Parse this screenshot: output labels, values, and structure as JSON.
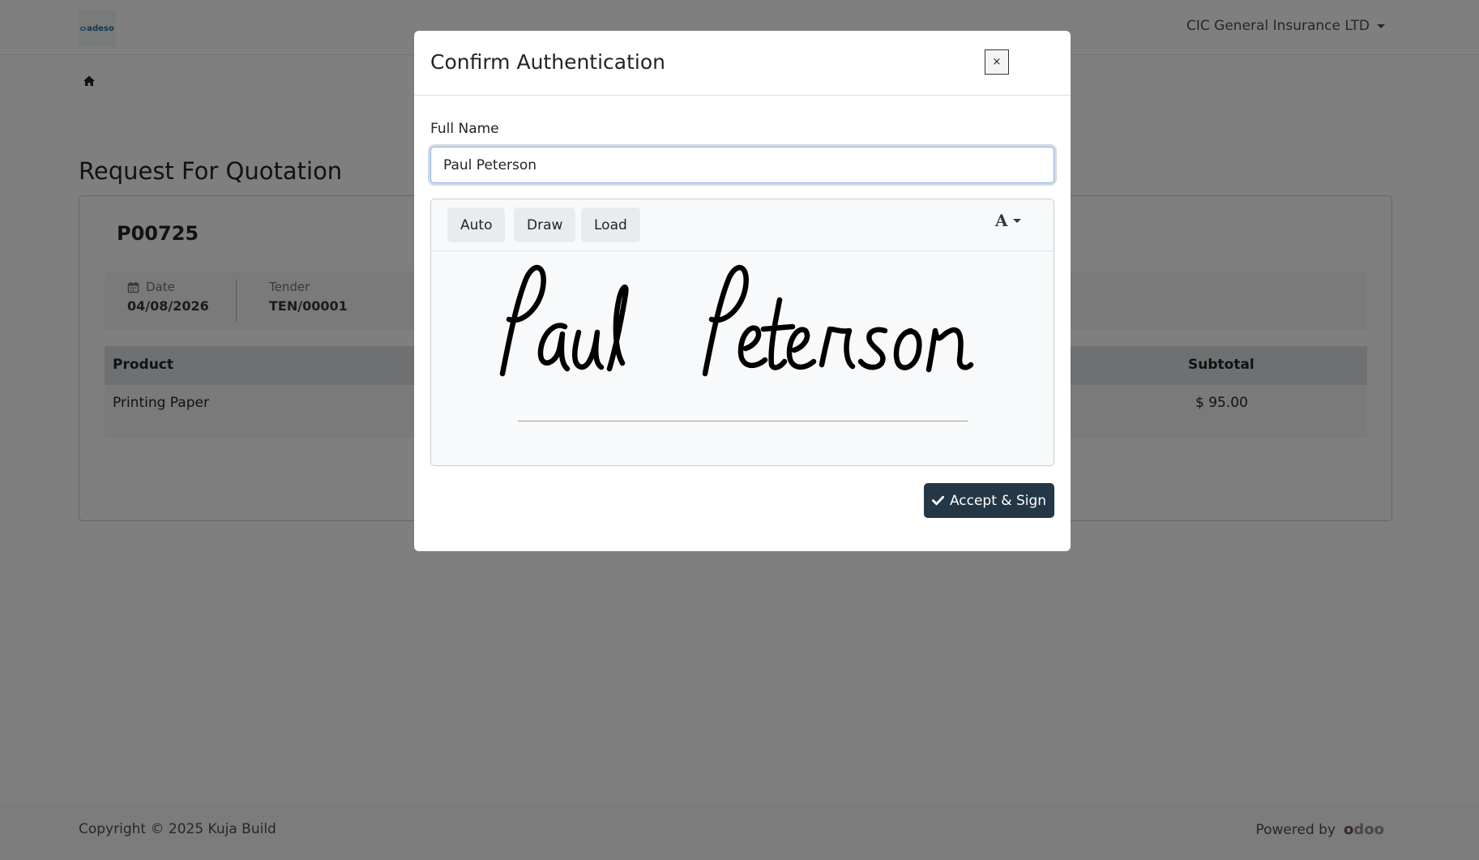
{
  "navbar": {
    "logo_text": "adeso",
    "company": "CIC General Insurance LTD"
  },
  "page": {
    "title": "Request For Quotation",
    "po_number": "P00725",
    "date_label": "Date",
    "date_value": "04/08/2026",
    "tender_label": "Tender",
    "tender_value": "TEN/00001",
    "table": {
      "headers": {
        "product": "Product",
        "subtotal": "Subtotal"
      },
      "rows": [
        {
          "product": "Printing Paper",
          "subtotal": "$ 95.00"
        }
      ]
    }
  },
  "footer": {
    "copyright": "Copyright © 2025 Kuja Build",
    "powered_by": "Powered by",
    "odoo": "odoo"
  },
  "modal": {
    "title": "Confirm Authentication",
    "close_label": "×",
    "full_name_label": "Full Name",
    "full_name_value": "Paul Peterson",
    "modes": [
      "Auto",
      "Draw",
      "Load"
    ],
    "font_picker_glyph": "A",
    "signature_text": "Paul Peterson",
    "accept_label": "Accept & Sign"
  },
  "colors": {
    "accept_button": "#243746",
    "backdrop": "rgba(0,0,0,0.5)",
    "odoo_purple": "#714b67"
  },
  "icons": [
    "home-icon",
    "calendar-icon",
    "caret-down-icon",
    "check-icon",
    "close-icon",
    "font-icon"
  ]
}
